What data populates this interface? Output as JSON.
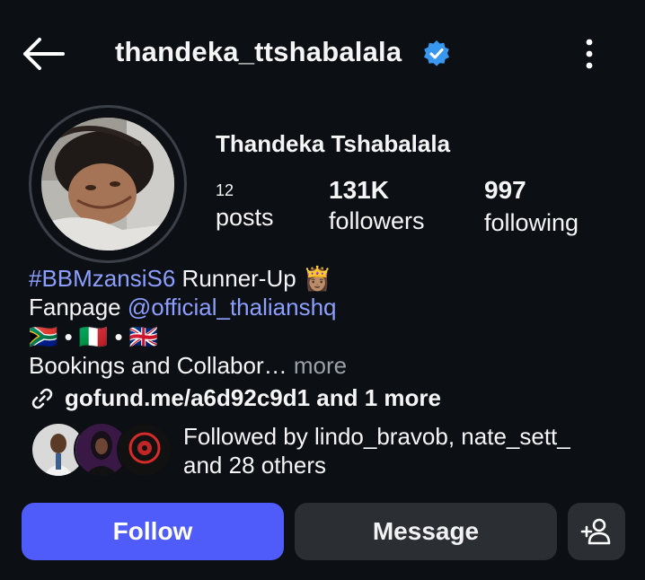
{
  "header": {
    "username": "thandeka_ttshabalala",
    "back_icon": "arrow-left-icon",
    "verified_icon": "verified-badge-icon",
    "more_icon": "more-vertical-icon"
  },
  "profile": {
    "display_name": "Thandeka Tshabalala",
    "stats": {
      "posts_count": "12",
      "posts_label": "posts",
      "followers_count": "131K",
      "followers_label": "followers",
      "following_count": "997",
      "following_label": "following"
    }
  },
  "bio": {
    "line1_hashtag": "#BBMzansiS6",
    "line1_text": " Runner-Up ",
    "line1_emoji": "👸🏽",
    "line2_text": "Fanpage ",
    "line2_mention": "@official_thalianshq",
    "line3_flags": "🇿🇦 • 🇮🇹 • 🇬🇧",
    "line4_text": "Bookings and Collabor… ",
    "line4_more": "more"
  },
  "link": {
    "icon": "link-icon",
    "text": "gofund.me/a6d92c9d1 and 1 more"
  },
  "followed_by": {
    "line1": "Followed by lindo_bravob, nate_sett_",
    "line2": "and 28 others"
  },
  "actions": {
    "follow_label": "Follow",
    "message_label": "Message",
    "add_user_icon": "add-person-icon"
  },
  "colors": {
    "background": "#0c0f14",
    "accent": "#4f5cfa",
    "link_blue": "#8c9fff",
    "verified": "#3897f0",
    "button_secondary": "#2b2e33"
  }
}
